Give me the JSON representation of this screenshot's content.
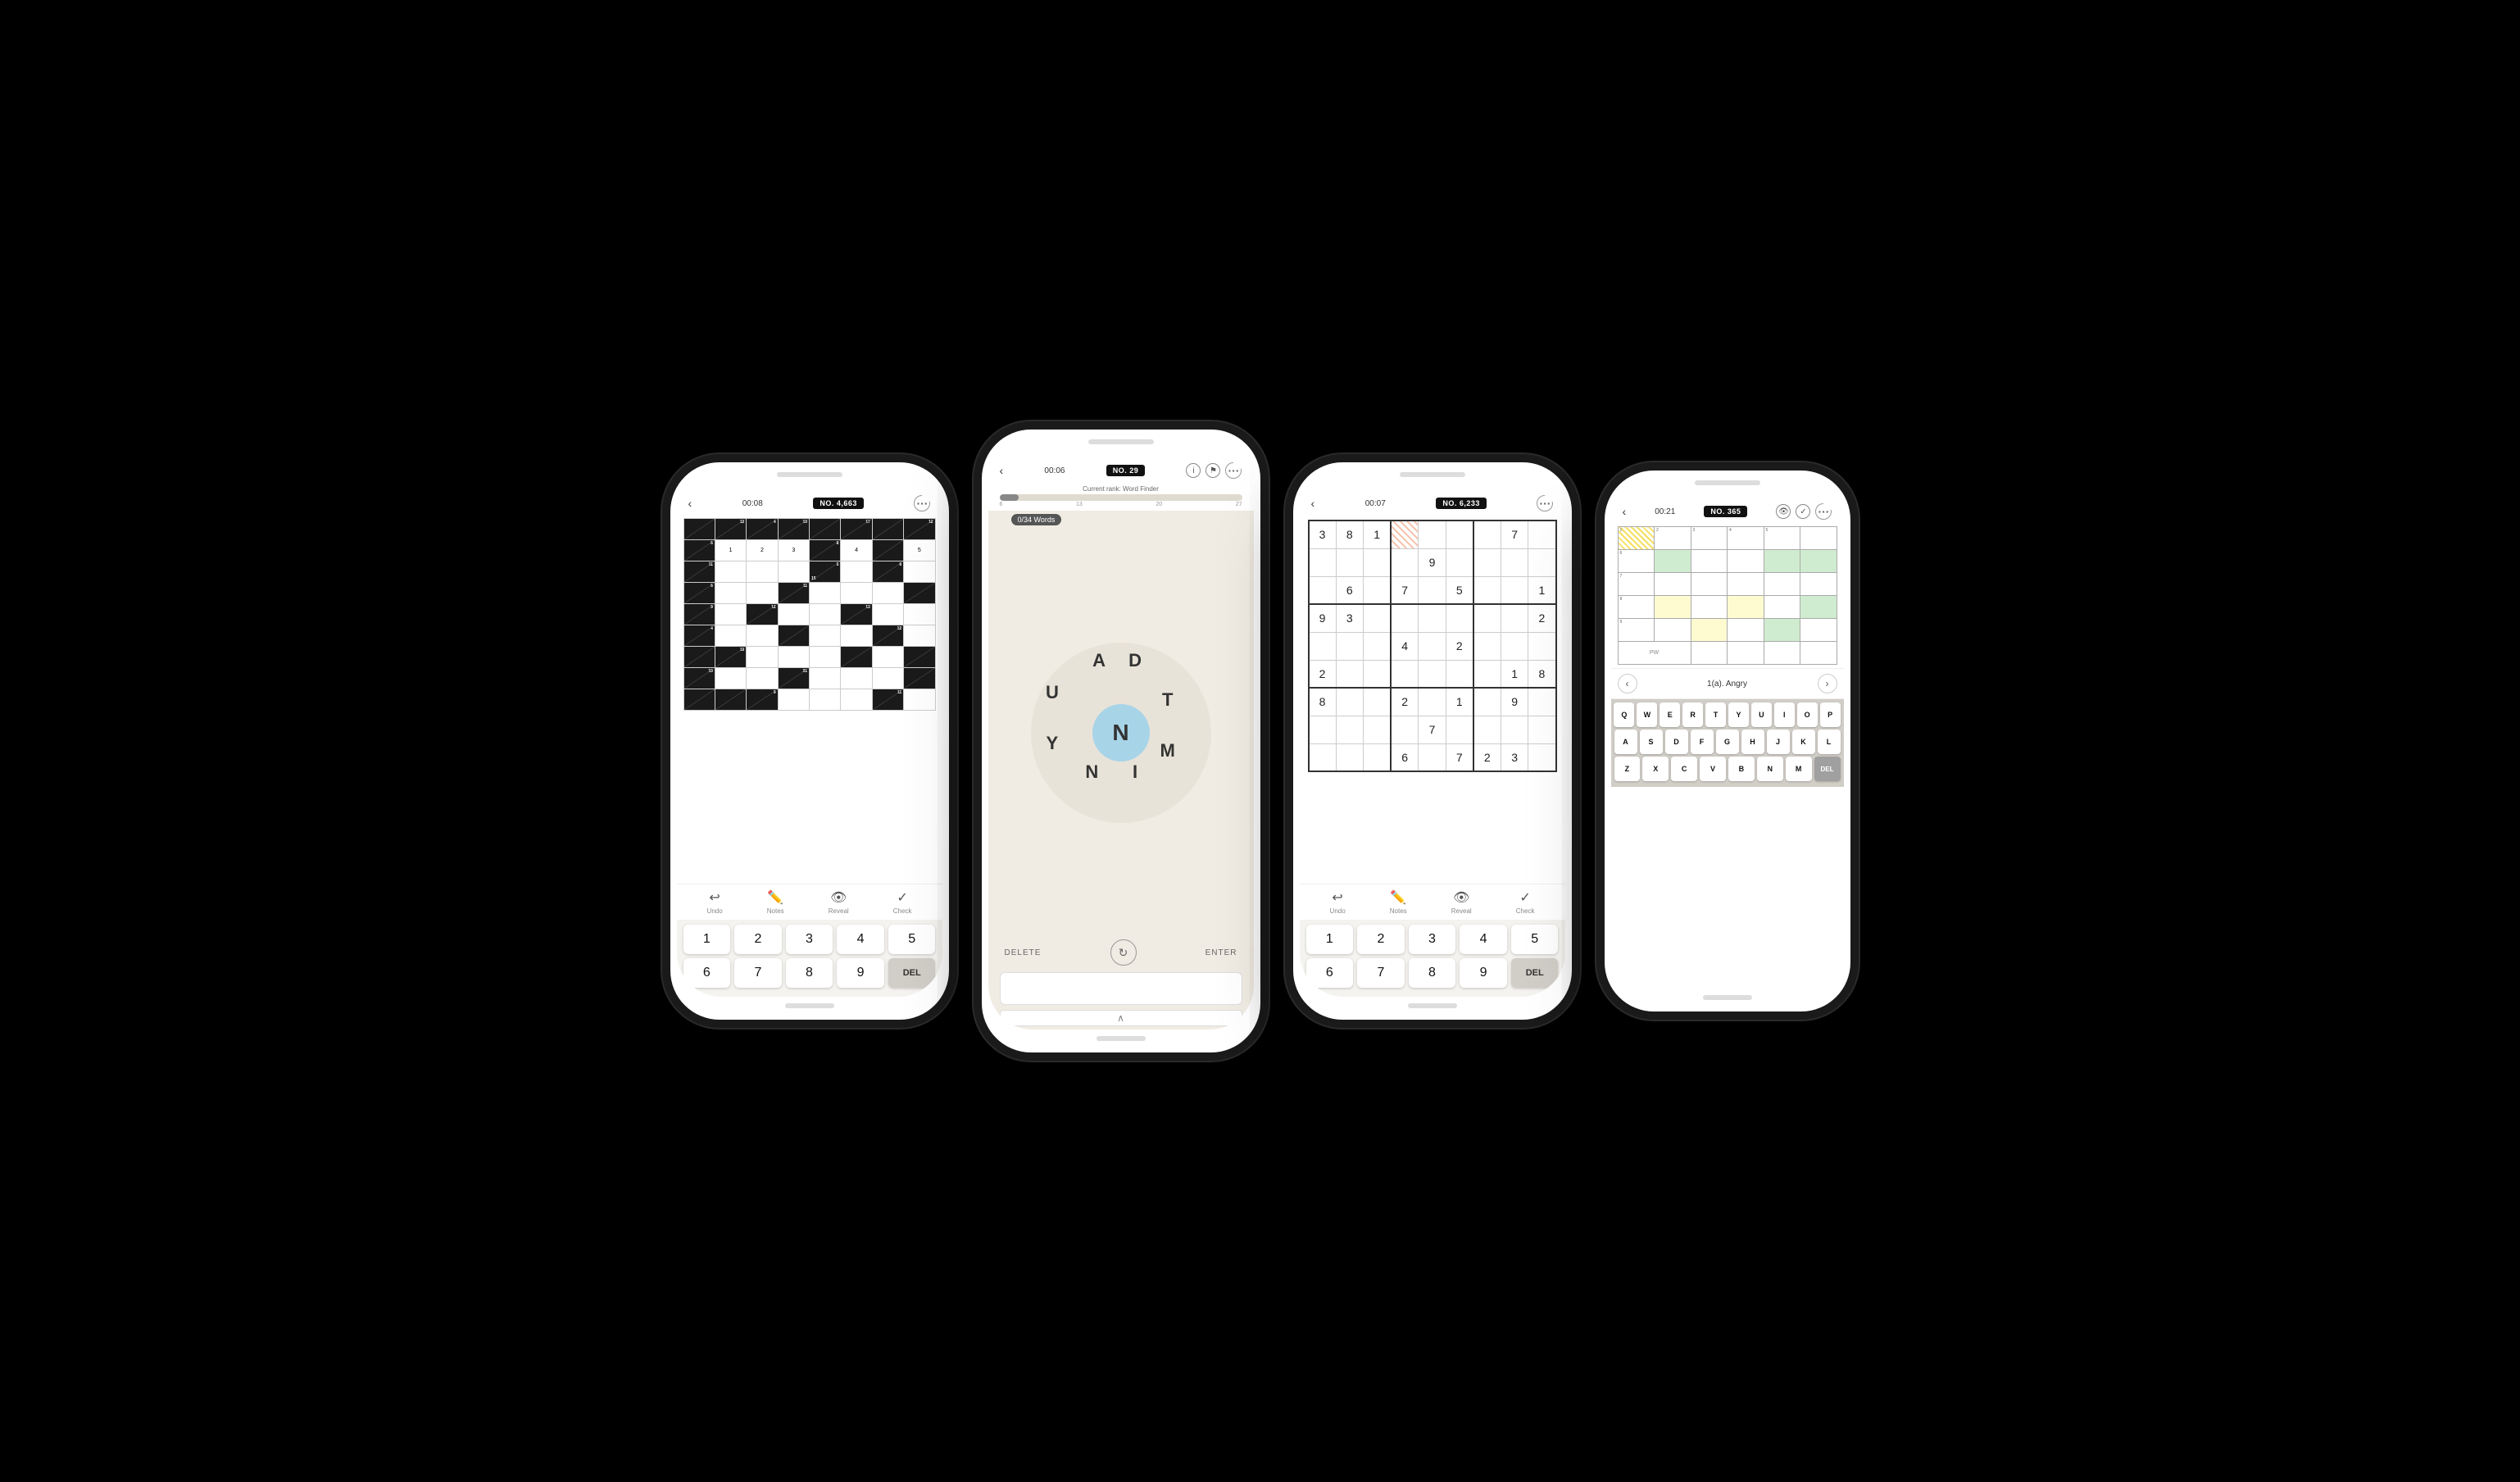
{
  "phones": [
    {
      "id": "phone1",
      "type": "kakuro",
      "header": {
        "back": "‹",
        "timer": "00:08",
        "badge": "NO. 4,663",
        "more": "···"
      },
      "actions": [
        "Undo",
        "Notes",
        "Reveal",
        "Check"
      ],
      "numpad": [
        "1",
        "2",
        "3",
        "4",
        "5",
        "6",
        "7",
        "8",
        "9",
        "DEL"
      ]
    },
    {
      "id": "phone2",
      "type": "wordfinder",
      "header": {
        "back": "‹",
        "timer": "00:06",
        "badge": "NO. 29",
        "info": "ⓘ",
        "flag": "⚑",
        "more": "···"
      },
      "rank_label": "Current rank: Word Finder",
      "rank_markers": [
        "6",
        "13",
        "20",
        "27"
      ],
      "words_count": "0/34 Words",
      "center_letter": "N",
      "outer_letters": [
        "A",
        "D",
        "T",
        "M",
        "I",
        "N",
        "Y",
        "U"
      ],
      "controls": {
        "delete": "DELETE",
        "enter": "ENTER"
      }
    },
    {
      "id": "phone3",
      "type": "sudoku",
      "header": {
        "back": "‹",
        "timer": "00:07",
        "badge": "NO. 6,233",
        "more": "···"
      },
      "actions": [
        "Undo",
        "Notes",
        "Reveal",
        "Check"
      ],
      "numpad": [
        "1",
        "2",
        "3",
        "4",
        "5",
        "6",
        "7",
        "8",
        "9",
        "DEL"
      ],
      "grid": [
        [
          "3",
          "8",
          "1",
          "",
          "",
          "",
          "",
          "7",
          ""
        ],
        [
          "",
          "",
          "",
          "",
          "9",
          "",
          "",
          "",
          ""
        ],
        [
          "",
          "6",
          "",
          "7",
          "",
          "5",
          "",
          "",
          "1"
        ],
        [
          "9",
          "3",
          "",
          "",
          "",
          "",
          "",
          "",
          "2"
        ],
        [
          "",
          "",
          "",
          "4",
          "",
          "2",
          "",
          "",
          ""
        ],
        [
          "2",
          "",
          "",
          "",
          "",
          "",
          "",
          "1",
          "8"
        ],
        [
          "8",
          "",
          "",
          "2",
          "",
          "1",
          "",
          "9",
          ""
        ],
        [
          "",
          "",
          "",
          "",
          "7",
          "",
          "",
          "",
          ""
        ],
        [
          "",
          "",
          "",
          "6",
          "",
          "7",
          "2",
          "3",
          ""
        ]
      ]
    },
    {
      "id": "phone4",
      "type": "crossword",
      "header": {
        "back": "‹",
        "timer": "00:21",
        "badge": "NO. 365",
        "more": "···"
      },
      "clue": "1(a). Angry",
      "keyboard_rows": [
        [
          "Q",
          "W",
          "E",
          "R",
          "T",
          "Y",
          "U",
          "I",
          "O",
          "P"
        ],
        [
          "A",
          "S",
          "D",
          "F",
          "G",
          "H",
          "J",
          "K",
          "L"
        ],
        [
          "Z",
          "X",
          "C",
          "V",
          "B",
          "N",
          "M",
          "DEL"
        ]
      ]
    }
  ]
}
